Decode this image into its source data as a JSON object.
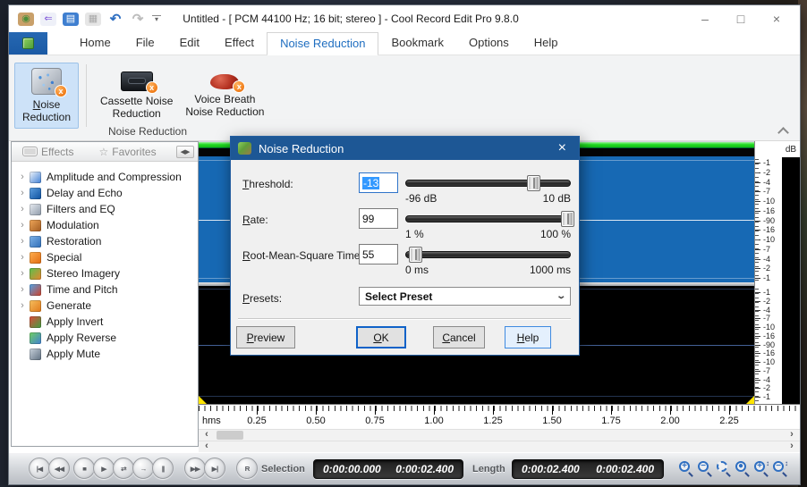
{
  "window": {
    "title": "Untitled - [ PCM 44100 Hz; 16 bit; stereo ] - Cool Record Edit Pro 9.8.0",
    "controls": [
      {
        "name": "minimize-button",
        "glyph": "–"
      },
      {
        "name": "maximize-button",
        "glyph": "□"
      },
      {
        "name": "close-button",
        "glyph": "×"
      }
    ]
  },
  "qat": [
    {
      "name": "app-logo-icon",
      "glyph": "◉",
      "fg": "#4a8f3a",
      "bg": "#c9a06a"
    },
    {
      "name": "import-icon",
      "glyph": "⇐",
      "fg": "#7a4fd8",
      "bg": "#eef0f8"
    },
    {
      "name": "open-icon",
      "glyph": "▤",
      "fg": "#ffffff",
      "bg": "#3f7fd0"
    },
    {
      "name": "save-icon",
      "glyph": "▦",
      "fg": "#a8a8a8",
      "bg": "#e6e6e6"
    },
    {
      "name": "undo-icon",
      "glyph": "↶",
      "fg": "#2f6fc1",
      "bg": "transparent"
    },
    {
      "name": "redo-icon",
      "glyph": "↷",
      "fg": "#bcbcbc",
      "bg": "transparent"
    },
    {
      "name": "customize-quick-access-icon",
      "glyph": "▾",
      "fg": "#666666",
      "bg": "transparent"
    }
  ],
  "tabs": [
    {
      "label": "Home",
      "selected": false
    },
    {
      "label": "File",
      "selected": false
    },
    {
      "label": "Edit",
      "selected": false
    },
    {
      "label": "Effect",
      "selected": false
    },
    {
      "label": "Noise Reduction",
      "selected": true
    },
    {
      "label": "Bookmark",
      "selected": false
    },
    {
      "label": "Options",
      "selected": false
    },
    {
      "label": "Help",
      "selected": false
    }
  ],
  "ribbon": {
    "group_label": "Noise Reduction",
    "buttons": [
      {
        "label": "Noise\nReduction",
        "ukey": 0,
        "icon": "noise-reduction-icon",
        "selected": true
      },
      {
        "label": "Cassette Noise\nReduction",
        "icon": "cassette-noise-reduction-icon",
        "selected": false
      },
      {
        "label": "Voice Breath\nNoise Reduction",
        "icon": "voice-breath-noise-reduction-icon",
        "selected": false
      }
    ]
  },
  "sidebar": {
    "tabs": [
      {
        "label": "Effects",
        "icon": "effects-icon"
      },
      {
        "label": "Favorites",
        "icon": "favorites-star-icon"
      }
    ],
    "items": [
      {
        "label": "Amplitude and Compression",
        "icon": "amplitude-icon",
        "expandable": true,
        "c1": "#f2f6fb",
        "c2": "#3f7fd4"
      },
      {
        "label": "Delay and Echo",
        "icon": "delay-echo-icon",
        "expandable": true,
        "c1": "#5fa0e0",
        "c2": "#0c4f9e"
      },
      {
        "label": "Filters and EQ",
        "icon": "filters-eq-icon",
        "expandable": true,
        "c1": "#e8ecf2",
        "c2": "#8d99a8"
      },
      {
        "label": "Modulation",
        "icon": "modulation-icon",
        "expandable": true,
        "c1": "#f0a75a",
        "c2": "#a05a20"
      },
      {
        "label": "Restoration",
        "icon": "restoration-icon",
        "expandable": true,
        "c1": "#7fb3e8",
        "c2": "#2d6db8"
      },
      {
        "label": "Special",
        "icon": "special-icon",
        "expandable": true,
        "c1": "#ffb050",
        "c2": "#e06a10"
      },
      {
        "label": "Stereo Imagery",
        "icon": "stereo-imagery-icon",
        "expandable": true,
        "c1": "#58c24e",
        "c2": "#e8852c"
      },
      {
        "label": "Time and Pitch",
        "icon": "time-pitch-icon",
        "expandable": true,
        "c1": "#4fa3e8",
        "c2": "#d04028"
      },
      {
        "label": "Generate",
        "icon": "generate-icon",
        "expandable": true,
        "c1": "#f6c060",
        "c2": "#e07818"
      },
      {
        "label": "Apply Invert",
        "icon": "apply-invert-icon",
        "expandable": false,
        "c1": "#e04a3a",
        "c2": "#3f9e3f"
      },
      {
        "label": "Apply Reverse",
        "icon": "apply-reverse-icon",
        "expandable": false,
        "c1": "#70d060",
        "c2": "#3f7fd4"
      },
      {
        "label": "Apply Mute",
        "icon": "apply-mute-icon",
        "expandable": false,
        "c1": "#c8d2dc",
        "c2": "#5f6f80"
      }
    ]
  },
  "waveform": {
    "db_unit": "dB",
    "scale": [
      "-1",
      "-2",
      "-4",
      "-7",
      "-10",
      "-16",
      "-90",
      "-16",
      "-10",
      "-7",
      "-4",
      "-2",
      "-1"
    ]
  },
  "timeline": {
    "unit": "hms",
    "ticks": [
      "0.25",
      "0.50",
      "0.75",
      "1.00",
      "1.25",
      "1.50",
      "1.75",
      "2.00",
      "2.25"
    ]
  },
  "dialog": {
    "title": "Noise Reduction",
    "fields": [
      {
        "label": "Threshold:",
        "ukey": 0,
        "value": "-13",
        "value_selected": true,
        "min_label": "-96 dB",
        "max_label": "10 dB",
        "slider_percent": 78
      },
      {
        "label": "Rate:",
        "ukey": 0,
        "value": "99",
        "value_selected": false,
        "min_label": "1 %",
        "max_label": "100 %",
        "slider_percent": 99
      },
      {
        "label": "Root-Mean-Square Time:",
        "ukey": 0,
        "value": "55",
        "value_selected": false,
        "min_label": "0 ms",
        "max_label": "1000 ms",
        "slider_percent": 6
      }
    ],
    "presets": {
      "label": "Presets:",
      "ukey": 0,
      "value": "Select Preset"
    },
    "buttons": [
      {
        "label": "Preview",
        "ukey": 0,
        "style": "normal"
      },
      {
        "label": "OK",
        "ukey": 0,
        "style": "default"
      },
      {
        "label": "Cancel",
        "ukey": 0,
        "style": "normal"
      },
      {
        "label": "Help",
        "ukey": 0,
        "style": "focus"
      }
    ]
  },
  "transport": {
    "buttons": [
      {
        "name": "go-to-start-button",
        "glyph": "|◀"
      },
      {
        "name": "rewind-button",
        "glyph": "◀◀"
      },
      {
        "name": "stop-button",
        "glyph": "■"
      },
      {
        "name": "play-button",
        "glyph": "▶"
      },
      {
        "name": "loop-play-button",
        "glyph": "⇄"
      },
      {
        "name": "play-selection-button",
        "glyph": "→"
      },
      {
        "name": "pause-button",
        "glyph": "||"
      },
      {
        "name": "fast-forward-button",
        "glyph": "▶▶"
      },
      {
        "name": "go-to-end-button",
        "glyph": "▶|"
      },
      {
        "name": "record-button",
        "glyph": "R"
      }
    ],
    "selection_label": "Selection",
    "selection_start": "0:00:00.000",
    "selection_end": "0:00:02.400",
    "length_label": "Length",
    "length_value": "0:00:02.400",
    "length_total": "0:00:02.400",
    "zoom_buttons": [
      {
        "name": "zoom-in-button",
        "sign": "+",
        "variant": ""
      },
      {
        "name": "zoom-out-button",
        "sign": "−",
        "variant": ""
      },
      {
        "name": "zoom-to-selection-button",
        "sign": "",
        "variant": "sel"
      },
      {
        "name": "zoom-full-button",
        "sign": "●",
        "variant": ""
      },
      {
        "name": "vertical-zoom-in-button",
        "sign": "+",
        "variant": "vert"
      },
      {
        "name": "vertical-zoom-out-button",
        "sign": "−",
        "variant": "vert"
      }
    ]
  },
  "colors": {
    "accent_blue": "#1f6ec0",
    "dialog_title_bg": "#1d5795",
    "selection_wave": "#1769b4",
    "position_green": "#23dd23",
    "marker_yellow": "#ffe400"
  }
}
